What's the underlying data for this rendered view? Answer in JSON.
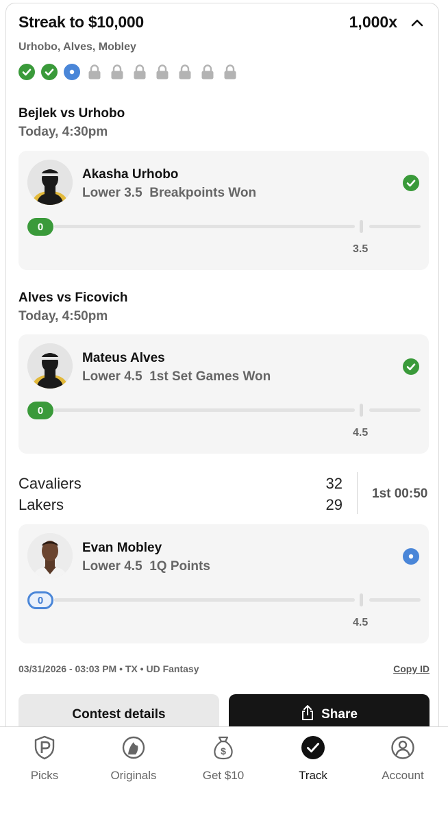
{
  "header": {
    "title": "Streak to $10,000",
    "multiplier": "1,000x",
    "players": "Urhobo, Alves, Mobley"
  },
  "streak": [
    "won",
    "won",
    "live",
    "locked",
    "locked",
    "locked",
    "locked",
    "locked",
    "locked",
    "locked"
  ],
  "games": [
    {
      "title": "Bejlek vs Urhobo",
      "time": "Today, 4:30pm",
      "pick": {
        "name": "Akasha Urhobo",
        "direction": "Lower",
        "line": "3.5",
        "stat": "Breakpoints Won",
        "current": "0",
        "threshold": "3.5",
        "status": "won"
      }
    },
    {
      "title": "Alves vs Ficovich",
      "time": "Today, 4:50pm",
      "pick": {
        "name": "Mateus Alves",
        "direction": "Lower",
        "line": "4.5",
        "stat": "1st Set Games Won",
        "current": "0",
        "threshold": "4.5",
        "status": "won"
      }
    },
    {
      "home_team": "Cavaliers",
      "home_score": "32",
      "away_team": "Lakers",
      "away_score": "29",
      "clock": "1st 00:50",
      "pick": {
        "name": "Evan Mobley",
        "direction": "Lower",
        "line": "4.5",
        "stat": "1Q Points",
        "current": "0",
        "threshold": "4.5",
        "status": "live"
      }
    }
  ],
  "footer": {
    "meta": "03/31/2026 - 03:03 PM • TX • UD Fantasy",
    "copy_id": "Copy ID"
  },
  "buttons": {
    "details": "Contest details",
    "share": "Share"
  },
  "nav": [
    {
      "label": "Picks",
      "icon": "picks-icon"
    },
    {
      "label": "Originals",
      "icon": "originals-icon"
    },
    {
      "label": "Get $10",
      "icon": "money-bag-icon"
    },
    {
      "label": "Track",
      "icon": "track-check-icon",
      "active": true
    },
    {
      "label": "Account",
      "icon": "account-icon"
    }
  ],
  "colors": {
    "won": "#3a9a3a",
    "live": "#4a86d8",
    "locked": "#b3b3b3",
    "dark": "#151515"
  }
}
